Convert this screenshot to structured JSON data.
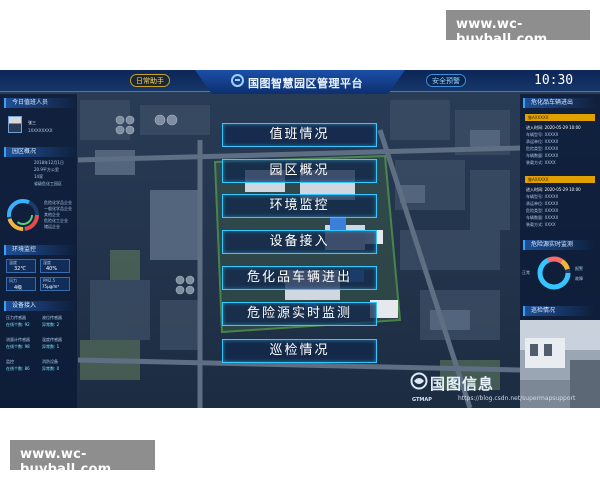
{
  "watermarks": {
    "top": "www.wc-buyball.com",
    "bottom": "www.wc-buyball.com"
  },
  "header": {
    "title": "国图智慧园区管理平台",
    "left_button": "日常助手",
    "right_button": "安全预警",
    "time": "10:30"
  },
  "left_panel": {
    "duty_title": "今日值班人员",
    "duty_name": "张三",
    "duty_phone": "1XXXXXXXX",
    "overview_title": "园区概况",
    "overview_lines": [
      "2018年12月1日",
      "20.9平方公里",
      "14家",
      "省级危化工园区"
    ],
    "ring_items": [
      "危险化学品企业",
      "一般化学品企业",
      "其他企业",
      "危险化工企业",
      "储运企业"
    ],
    "env_title": "环境监控",
    "env_values": [
      "32℃",
      "40%",
      "4级",
      "75μg/m³"
    ],
    "env_labels": [
      "温度",
      "湿度",
      "风力",
      "PM2.5"
    ],
    "device_title": "设备接入",
    "device_labels": [
      "压力传感器",
      "液位传感器",
      "流量计传感器",
      "温度传感器",
      "监控",
      "消防设备"
    ],
    "device_values": [
      "在线个数: 92",
      "异常数: 2",
      "在线个数: 98",
      "异常数: 1",
      "在线个数: 86",
      "异常数: 0"
    ]
  },
  "right_panel": {
    "vehicles_title": "危化品车辆进出",
    "vehicle_records": [
      {
        "plate": "鲁AXXXXX",
        "time": "进入时间: 2020-05-29 10:00",
        "lines": [
          "车辆型号: XXXXX",
          "承运单位: XXXXX",
          "危险类型: XXXXX",
          "车辆数量: XXXXX",
          "装载方式: XXXX"
        ]
      },
      {
        "plate": "鲁AXXXXX",
        "time": "进入时间: 2020-05-29 10:00",
        "lines": [
          "车辆型号: XXXXX",
          "承运单位: XXXXX",
          "危险类型: XXXXX",
          "车辆数量: XXXXX",
          "装载方式: XXXX"
        ]
      }
    ],
    "hazard_title": "危险源实时监测",
    "hazard_legend": [
      "正常",
      "报警",
      "故障"
    ],
    "inspection_title": "巡检情况"
  },
  "menu": {
    "items": [
      "值班情况",
      "园区概况",
      "环境监控",
      "设备接入",
      "危化品车辆进出",
      "危险源实时监测",
      "巡检情况"
    ]
  },
  "brand": {
    "name": "国图信息",
    "sub": "GTMAP",
    "url": "https://blog.csdn.net/supermapsupport"
  }
}
